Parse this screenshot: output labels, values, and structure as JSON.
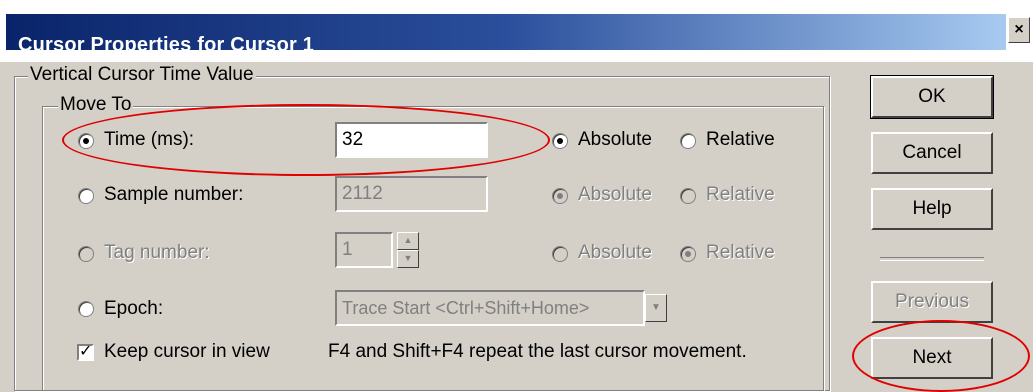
{
  "window": {
    "title": "Cursor Properties for Cursor 1",
    "close_glyph": "×"
  },
  "group_outer": {
    "legend": "Vertical Cursor Time Value"
  },
  "group_inner": {
    "legend": "Move To"
  },
  "rows": {
    "time": {
      "label": "Time (ms):",
      "value": "32",
      "absolute": "Absolute",
      "relative": "Relative",
      "selected": true,
      "mode": "absolute"
    },
    "sample": {
      "label": "Sample number:",
      "value": "2112",
      "absolute": "Absolute",
      "relative": "Relative",
      "mode": "absolute"
    },
    "tag": {
      "label": "Tag number:",
      "value": "1",
      "absolute": "Absolute",
      "relative": "Relative",
      "mode": "relative"
    },
    "epoch": {
      "label": "Epoch:",
      "value": "Trace Start <Ctrl+Shift+Home>"
    }
  },
  "keep_cursor": {
    "label": "Keep cursor in view",
    "checked": true,
    "check_glyph": "✓"
  },
  "hint": "F4 and Shift+F4 repeat the last cursor movement.",
  "buttons": {
    "ok": "OK",
    "cancel": "Cancel",
    "help": "Help",
    "previous": "Previous",
    "next": "Next"
  },
  "annotation_color": "#e00000"
}
